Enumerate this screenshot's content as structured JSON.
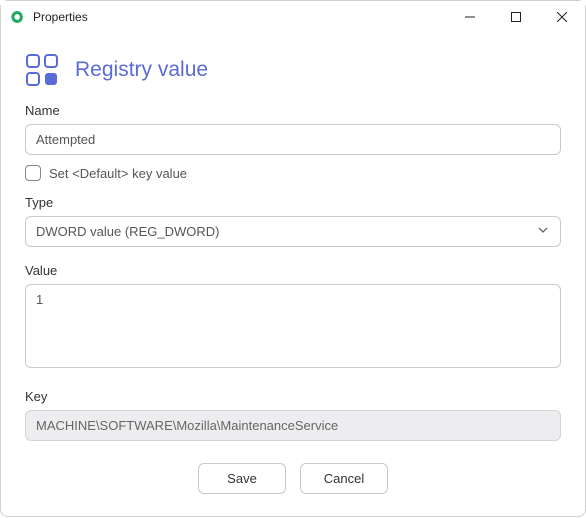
{
  "window": {
    "title": "Properties"
  },
  "header": {
    "title": "Registry value"
  },
  "fields": {
    "name": {
      "label": "Name",
      "value": "Attempted"
    },
    "defaultKey": {
      "label": "Set <Default> key value"
    },
    "type": {
      "label": "Type",
      "value": "DWORD value (REG_DWORD)"
    },
    "value": {
      "label": "Value",
      "value": "1"
    },
    "key": {
      "label": "Key",
      "value": "MACHINE\\SOFTWARE\\Mozilla\\MaintenanceService"
    }
  },
  "buttons": {
    "save": "Save",
    "cancel": "Cancel"
  }
}
